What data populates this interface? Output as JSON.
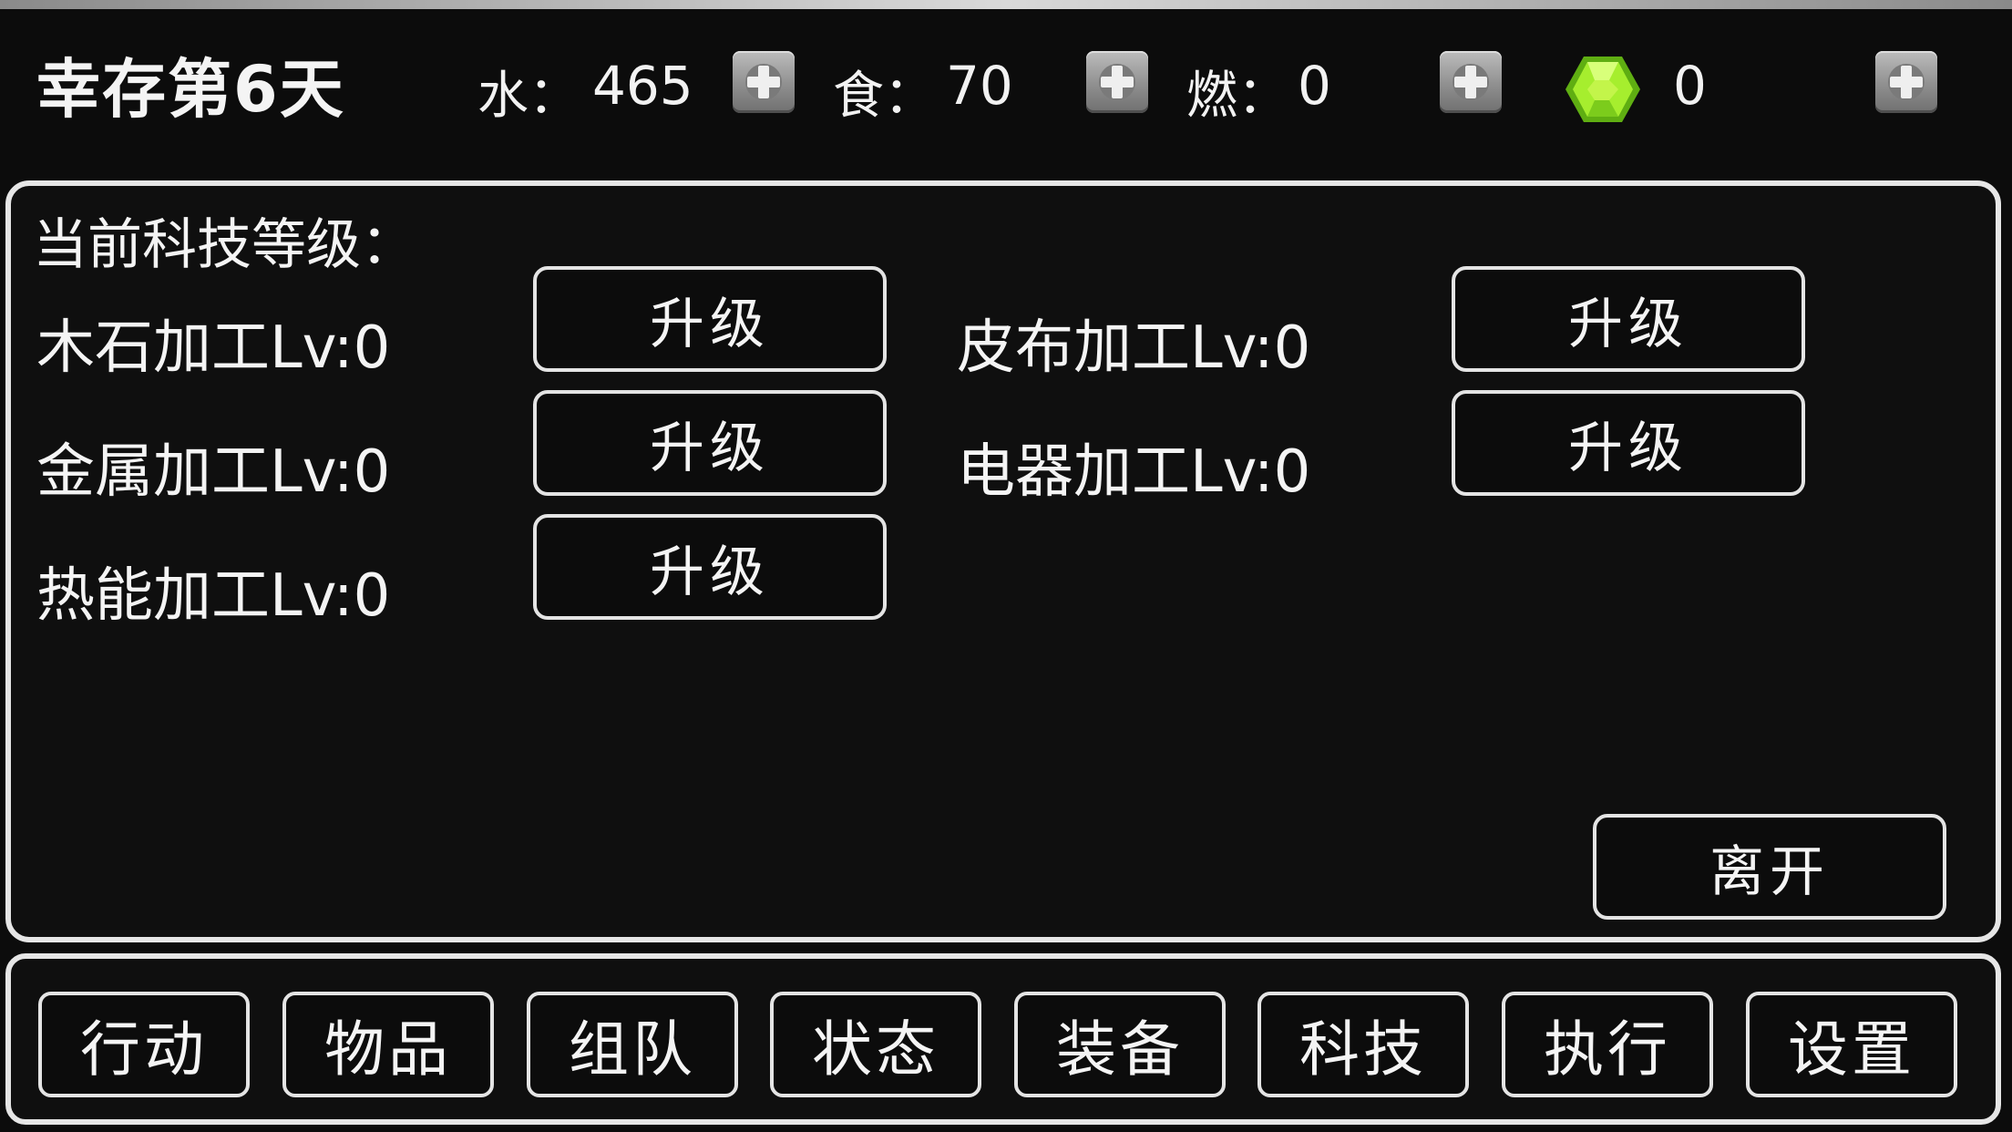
{
  "header": {
    "day_title": "幸存第6天",
    "resources": [
      {
        "label": "水：",
        "value": "465"
      },
      {
        "label": "食：",
        "value": "70"
      },
      {
        "label": "燃：",
        "value": "0"
      },
      {
        "label": "",
        "value": "0",
        "icon": "green-gem-icon"
      }
    ]
  },
  "tech_panel": {
    "title": "当前科技等级：",
    "items": [
      {
        "label": "木石加工Lv:0",
        "button": "升级"
      },
      {
        "label": "皮布加工Lv:0",
        "button": "升级"
      },
      {
        "label": "金属加工Lv:0",
        "button": "升级"
      },
      {
        "label": "电器加工Lv:0",
        "button": "升级"
      },
      {
        "label": "热能加工Lv:0",
        "button": "升级"
      }
    ],
    "leave_button": "离开"
  },
  "nav": {
    "items": [
      "行动",
      "物品",
      "组队",
      "状态",
      "装备",
      "科技",
      "执行",
      "设置"
    ]
  },
  "colors": {
    "background": "#0c0c0c",
    "border": "#e6e6e6",
    "gem": "#9fe82a"
  }
}
